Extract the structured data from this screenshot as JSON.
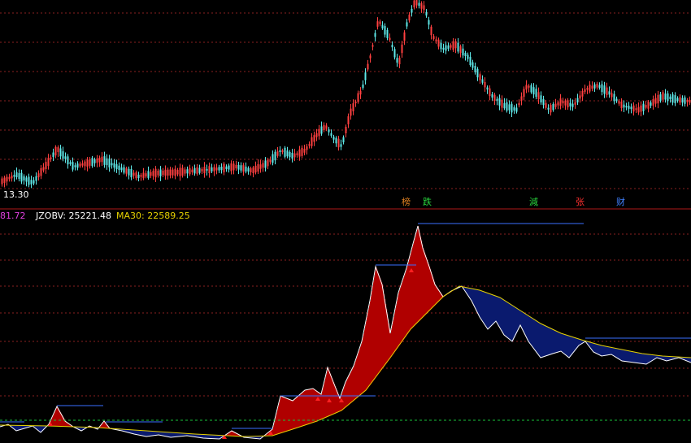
{
  "colors": {
    "background": "#000000",
    "grid": "#8a1f1f",
    "separator": "#b01818",
    "up_candle": "#ff4040",
    "down_candle": "#5ee8e8",
    "fill_above_ma": "#b00000",
    "fill_below_ma": "#0a1a6e",
    "obv_line": "#ffffff",
    "ma_line": "#e6d200",
    "level_line": "#3a6fff",
    "baseline": "#19c23a",
    "label_prev": "#e040e0",
    "label_obv": "#ffffff",
    "label_ma": "#e6d200"
  },
  "price_panel": {
    "low_label": "13.30",
    "badges": [
      {
        "text": "榜",
        "color": "#e08020",
        "icon": "list-badge"
      },
      {
        "text": "跌",
        "color": "#28d23c",
        "icon": "fall-badge"
      },
      {
        "text": "減",
        "color": "#28d23c",
        "icon": "reduce-badge"
      },
      {
        "text": "张",
        "color": "#ff3030",
        "icon": "rise-badge"
      },
      {
        "text": "财",
        "color": "#4080ff",
        "icon": "finance-badge"
      }
    ]
  },
  "indicator_panel": {
    "prev_value": "81.72",
    "obv_label": "JZOBV: 25221.48",
    "ma_label": "MA30: 22589.25"
  }
}
